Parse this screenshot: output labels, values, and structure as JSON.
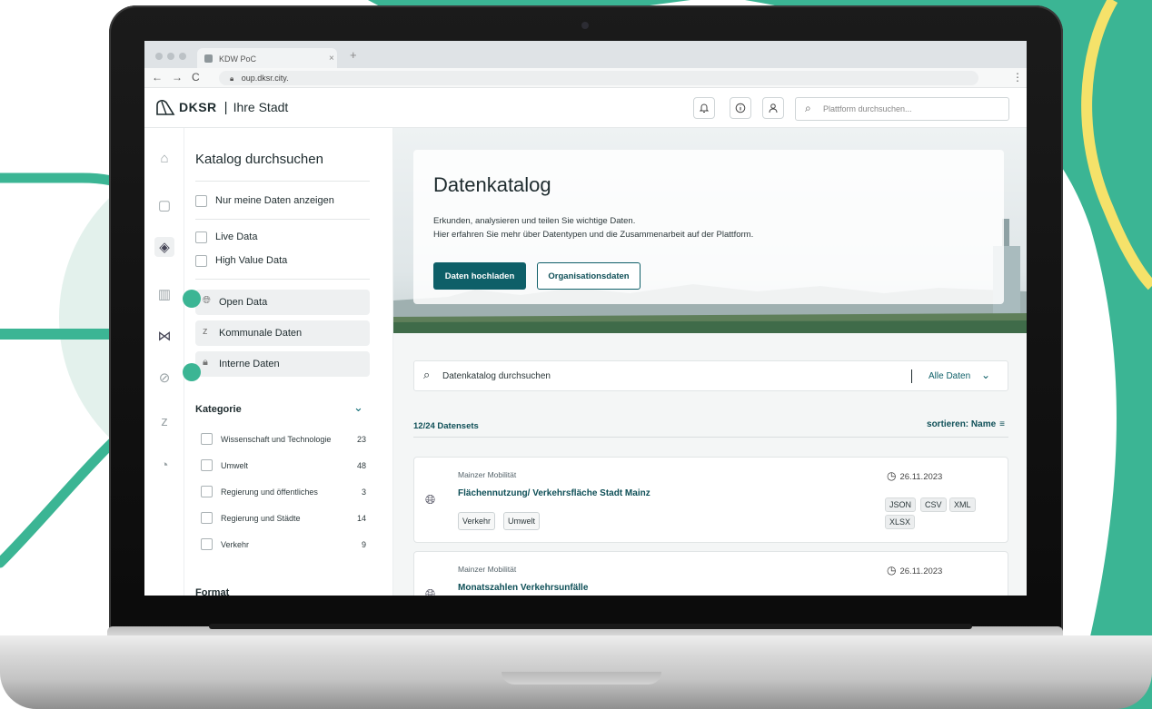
{
  "browser": {
    "tab_title": "KDW PoC",
    "tab_close": "×",
    "new_tab": "+",
    "url": "oup.dksr.city.",
    "nav_back": "←",
    "nav_forward": "→",
    "nav_reload": "C",
    "menu": "⋮"
  },
  "header": {
    "brand": "DKSR",
    "separator": "|",
    "city": "Ihre Stadt",
    "search_placeholder": "Plattform durchsuchen..."
  },
  "sidebar": {
    "title": "Katalog durchsuchen",
    "checkboxes": [
      {
        "label": "Nur meine Daten anzeigen"
      },
      {
        "label": "Live Data"
      },
      {
        "label": "High Value Data"
      }
    ],
    "pills": [
      {
        "label": "Open Data"
      },
      {
        "label": "Kommunale Daten"
      },
      {
        "label": "Interne Daten"
      }
    ],
    "category_section": "Kategorie",
    "categories": [
      {
        "label": "Wissenschaft und Technologie",
        "count": "23"
      },
      {
        "label": "Umwelt",
        "count": "48"
      },
      {
        "label": "Regierung und öffentliches",
        "count": "3"
      },
      {
        "label": "Regierung und Städte",
        "count": "14"
      },
      {
        "label": "Verkehr",
        "count": "9"
      }
    ],
    "format_section": "Format"
  },
  "hero": {
    "title": "Datenkatalog",
    "line1": "Erkunden, analysieren und teilen Sie wichtige Daten.",
    "line2": "Hier erfahren Sie mehr über Datentypen und die Zusammenarbeit auf der Plattform.",
    "primary_button": "Daten hochladen",
    "secondary_button": "Organisationsdaten"
  },
  "catalog": {
    "search_placeholder": "Datenkatalog durchsuchen",
    "filter_label": "Alle Daten",
    "count_label": "12/24 Datensets",
    "sort_label": "sortieren: Name",
    "items": [
      {
        "org": "Mainzer Mobilität",
        "title": "Flächennutzung/ Verkehrsfläche Stadt Mainz",
        "date": "26.11.2023",
        "tags": [
          "Verkehr",
          "Umwelt"
        ],
        "formats": [
          "JSON",
          "CSV",
          "XML",
          "XLSX"
        ]
      },
      {
        "org": "Mainzer Mobilität",
        "title": "Monatszahlen Verkehrsunfälle",
        "date": "26.11.2023"
      }
    ]
  },
  "colors": {
    "teal": "#3bb594",
    "yellow": "#f5e26a",
    "primary": "#0e5f68"
  }
}
